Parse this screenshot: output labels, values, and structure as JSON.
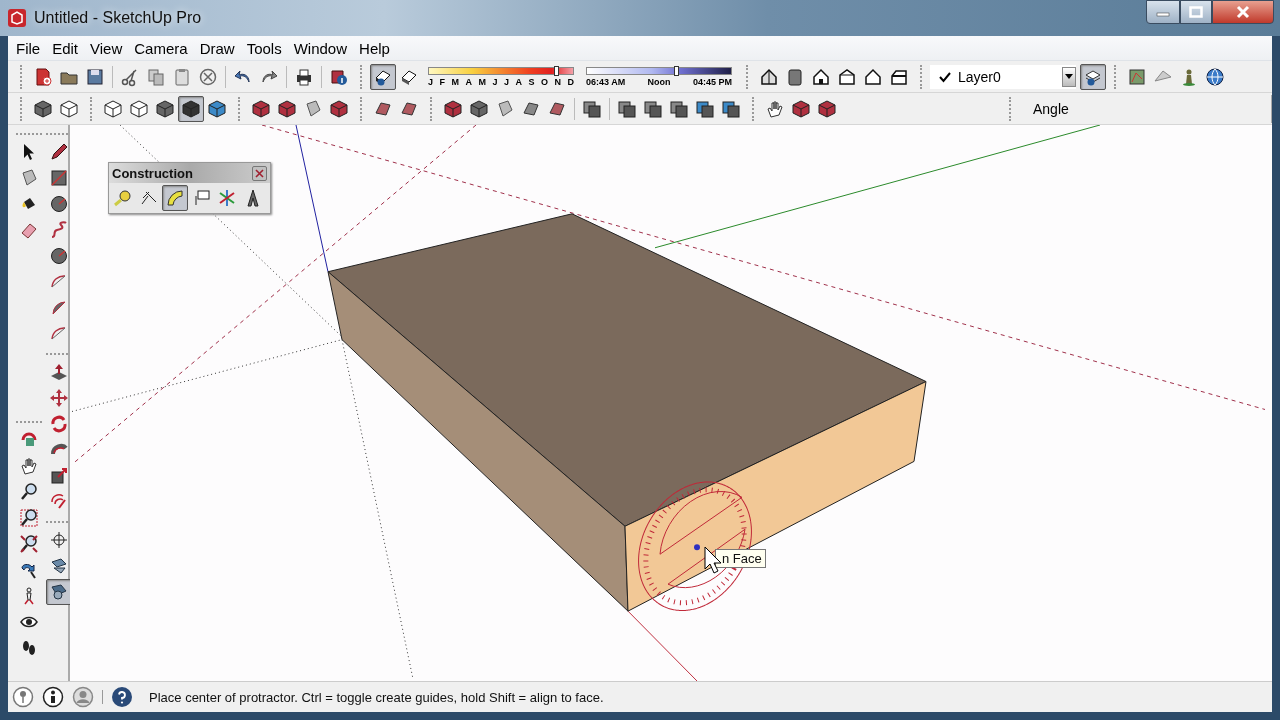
{
  "window": {
    "title": "Untitled - SketchUp Pro"
  },
  "menu": [
    {
      "label": "File"
    },
    {
      "label": "Edit"
    },
    {
      "label": "View"
    },
    {
      "label": "Camera"
    },
    {
      "label": "Draw"
    },
    {
      "label": "Tools"
    },
    {
      "label": "Window"
    },
    {
      "label": "Help"
    }
  ],
  "toolbar_row_1": [
    {
      "selected": false
    },
    {
      "selected": false
    },
    {
      "selected": false
    },
    {
      "selected": false
    },
    {
      "selected": false
    },
    {
      "selected": false
    },
    {
      "selected": false
    },
    {
      "selected": false
    },
    {
      "selected": false
    },
    {
      "selected": false
    },
    {
      "selected": false
    },
    {
      "selected": true
    },
    {
      "selected": false
    },
    {
      "selected": false
    },
    {
      "selected": false
    },
    {
      "selected": false
    },
    {
      "selected": false
    },
    {
      "selected": false
    },
    {
      "selected": false
    },
    {
      "selected": true
    },
    {
      "selected": false
    },
    {
      "selected": false
    },
    {
      "selected": false
    },
    {
      "selected": false
    }
  ],
  "date_slider": {
    "level": 0.88,
    "months": [
      "J",
      "F",
      "M",
      "A",
      "M",
      "J",
      "J",
      "A",
      "S",
      "O",
      "N",
      "D"
    ]
  },
  "time_slider": {
    "level": 0.62,
    "times": [
      "06:43 AM",
      "Noon",
      "04:45 PM"
    ]
  },
  "layer": {
    "current": true,
    "name": "Layer0"
  },
  "toolbar_row_2": [
    {
      "selected": false
    },
    {
      "selected": false
    },
    {
      "selected": false
    },
    {
      "selected": false
    },
    {
      "selected": false
    },
    {
      "selected": true
    },
    {
      "selected": false
    },
    {
      "selected": false
    },
    {
      "selected": false
    },
    {
      "selected": false
    },
    {
      "selected": false
    },
    {
      "selected": false
    },
    {
      "selected": false
    },
    {
      "selected": false
    },
    {
      "selected": false
    },
    {
      "selected": false
    },
    {
      "selected": false
    },
    {
      "selected": false
    },
    {
      "selected": false
    },
    {
      "selected": false
    },
    {
      "selected": false
    },
    {
      "selected": false
    },
    {
      "selected": false
    },
    {
      "selected": false
    },
    {
      "selected": false
    },
    {
      "selected": false
    },
    {
      "selected": false
    }
  ],
  "measurements": {
    "label": "Angle"
  },
  "left_toolbar": {
    "column_1": [
      {
        "selected": false
      },
      {
        "selected": false
      },
      {
        "selected": false
      },
      {
        "selected": false
      },
      {
        "selected": false
      },
      {
        "selected": false
      },
      {
        "selected": false
      },
      {
        "selected": false
      },
      {
        "selected": false
      },
      {
        "selected": false
      },
      {
        "selected": false
      },
      {
        "selected": false
      },
      {
        "selected": false
      }
    ],
    "column_2": [
      {
        "selected": false
      },
      {
        "selected": false
      },
      {
        "selected": false
      },
      {
        "selected": false
      },
      {
        "selected": false
      },
      {
        "selected": false
      },
      {
        "selected": false
      },
      {
        "selected": false
      },
      {
        "selected": false
      },
      {
        "selected": false
      },
      {
        "selected": false
      },
      {
        "selected": false
      },
      {
        "selected": false
      },
      {
        "selected": false
      },
      {
        "selected": false
      },
      {
        "selected": false
      },
      {
        "selected": true
      }
    ]
  },
  "construction_palette": {
    "title": "Construction",
    "tools": [
      {
        "selected": false
      },
      {
        "selected": false
      },
      {
        "selected": true
      },
      {
        "selected": false
      },
      {
        "selected": false
      },
      {
        "selected": false
      }
    ]
  },
  "viewport": {
    "tooltip": "n Face"
  },
  "status_bar": {
    "message": "Place center of protractor. Ctrl = toggle create guides, hold Shift = align to face."
  }
}
